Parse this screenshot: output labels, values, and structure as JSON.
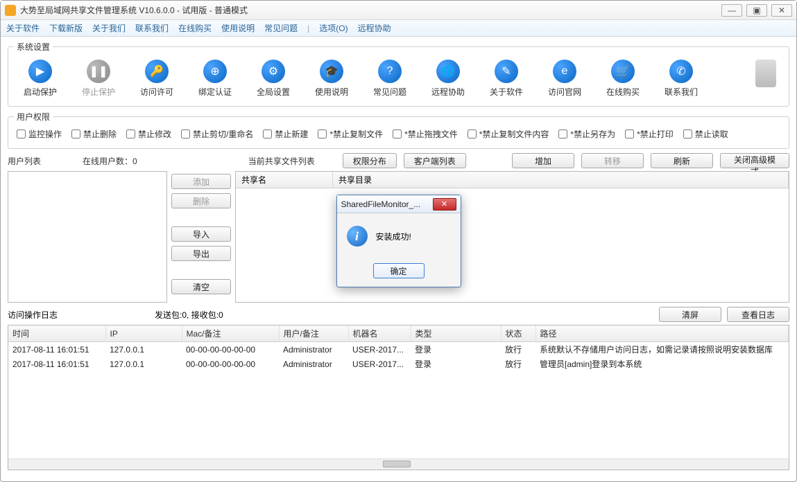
{
  "window": {
    "title": "大势至局域网共享文件管理系统 V10.6.0.0 - 试用版 - 普通模式"
  },
  "menu": {
    "items": [
      "关于软件",
      "下载新版",
      "关于我们",
      "联系我们",
      "在线购买",
      "使用说明",
      "常见问题"
    ],
    "option": "选项(O)",
    "remote": "远程协助"
  },
  "toolbar_legend": "系统设置",
  "tools": [
    {
      "label": "启动保护",
      "glyph": "▶"
    },
    {
      "label": "停止保护",
      "glyph": "❚❚",
      "disabled": true
    },
    {
      "label": "访问许可",
      "glyph": "🔑"
    },
    {
      "label": "绑定认证",
      "glyph": "⊕"
    },
    {
      "label": "全局设置",
      "glyph": "⚙"
    },
    {
      "label": "使用说明",
      "glyph": "🎓"
    },
    {
      "label": "常见问题",
      "glyph": "?"
    },
    {
      "label": "远程协助",
      "glyph": "🌐"
    },
    {
      "label": "关于软件",
      "glyph": "✎"
    },
    {
      "label": "访问官网",
      "glyph": "e"
    },
    {
      "label": "在线购买",
      "glyph": "🛒"
    },
    {
      "label": "联系我们",
      "glyph": "✆"
    }
  ],
  "perm_legend": "用户权限",
  "perms": [
    "监控操作",
    "禁止删除",
    "禁止修改",
    "禁止剪切/重命名",
    "禁止新建",
    "*禁止复制文件",
    "*禁止拖拽文件",
    "*禁止复制文件内容",
    "*禁止另存为",
    "*禁止打印",
    "禁止读取"
  ],
  "labels": {
    "userlist": "用户列表",
    "online_count_label": "在线用户数：",
    "online_count": "0",
    "sharelist": "当前共享文件列表",
    "share_col1": "共享名",
    "share_col2": "共享目录",
    "log_title": "访问操作日志",
    "stats": "发送包:0, 接收包:0"
  },
  "buttons": {
    "perm_dist": "权限分布",
    "client_list": "客户端列表",
    "add": "增加",
    "transfer": "转移",
    "refresh": "刷新",
    "close_adv": "关闭高级模式",
    "u_add": "添加",
    "u_del": "删除",
    "u_import": "导入",
    "u_export": "导出",
    "u_clear": "清空",
    "clear_screen": "清屏",
    "view_log": "查看日志"
  },
  "log_cols": [
    "时间",
    "IP",
    "Mac/备注",
    "用户/备注",
    "机器名",
    "类型",
    "状态",
    "路径"
  ],
  "log_rows": [
    {
      "time": "2017-08-11 16:01:51",
      "ip": "127.0.0.1",
      "mac": "00-00-00-00-00-00",
      "user": "Administrator",
      "host": "USER-2017...",
      "type": "登录",
      "state": "放行",
      "path": "系统默认不存储用户访问日志，如需记录请按照说明安装数据库"
    },
    {
      "time": "2017-08-11 16:01:51",
      "ip": "127.0.0.1",
      "mac": "00-00-00-00-00-00",
      "user": "Administrator",
      "host": "USER-2017...",
      "type": "登录",
      "state": "放行",
      "path": "管理员[admin]登录到本系统"
    }
  ],
  "dialog": {
    "title": "SharedFileMonitor_...",
    "message": "安装成功!",
    "ok": "确定"
  }
}
